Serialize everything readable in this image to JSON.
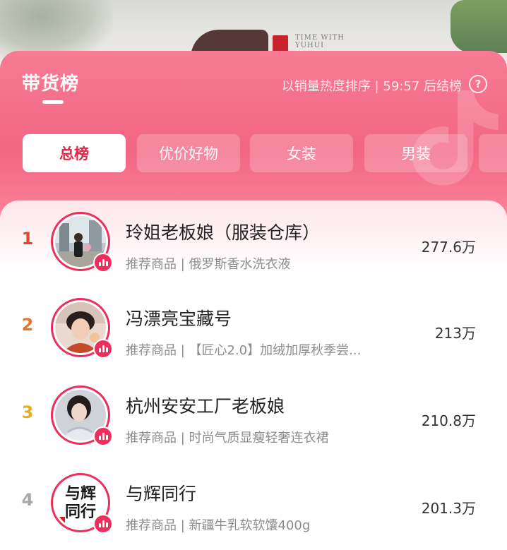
{
  "background": {
    "watermark_text": "TIME WITH YUHUI"
  },
  "header": {
    "title": "带货榜",
    "sort_info": "以销量热度排序 | 59:57 后结榜",
    "help_icon": "question-circle-icon"
  },
  "tabs": [
    {
      "label": "总榜",
      "active": true
    },
    {
      "label": "优价好物",
      "active": false
    },
    {
      "label": "女装",
      "active": false
    },
    {
      "label": "男装",
      "active": false
    }
  ],
  "colors": {
    "accent": "#ee2e5c",
    "rank1": "#e8422f",
    "rank2": "#ec7431",
    "rank3": "#e2b11d",
    "rank4": "#a9a9a9"
  },
  "rows": [
    {
      "rank": "1",
      "name": "玲姐老板娘（服装仓库）",
      "sub": "推荐商品 | 俄罗斯香水洗衣液",
      "value": "277.6万"
    },
    {
      "rank": "2",
      "name": "冯漂亮宝藏号",
      "sub": "推荐商品 | 【匠心2.0】加绒加厚秋季尝...",
      "value": "213万"
    },
    {
      "rank": "3",
      "name": "杭州安安工厂老板娘",
      "sub": "推荐商品 | 时尚气质显瘦轻奢连衣裙",
      "value": "210.8万"
    },
    {
      "rank": "4",
      "name": "与辉同行",
      "sub": "推荐商品 | 新疆牛乳软软馕400g",
      "value": "201.3万",
      "avatar_text": "与辉同行"
    }
  ]
}
